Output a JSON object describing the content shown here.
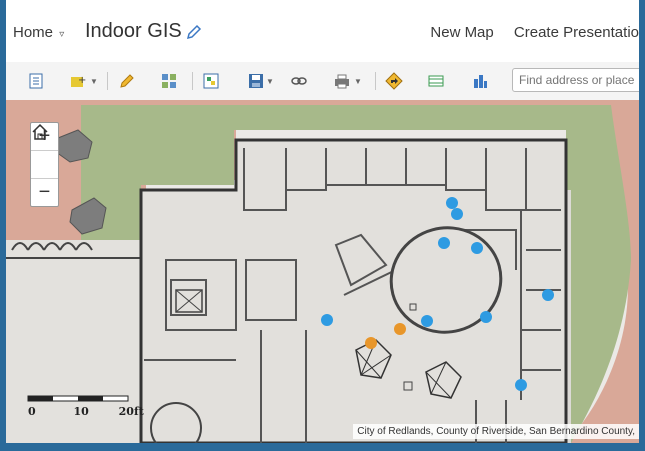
{
  "header": {
    "home_label": "Home",
    "home_caret": "▿",
    "app_title": "Indoor GIS",
    "nav": {
      "new_map": "New Map",
      "create_presentation": "Create Presentatio"
    }
  },
  "toolbar": {
    "search_placeholder": "Find address or place",
    "icons": [
      "details-icon",
      "add-content-icon",
      "edit-icon",
      "basemap-icon",
      "legend-icon",
      "save-icon",
      "share-link-icon",
      "print-icon",
      "directions-icon",
      "measure-icon",
      "analysis-icon"
    ]
  },
  "map": {
    "zoom_in": "+",
    "zoom_out": "−",
    "home_icon": "home-icon",
    "scale_labels": {
      "zero": "0",
      "ten": "10",
      "twenty": "20ft"
    },
    "attribution": "City of Redlands, County of Riverside, San Bernardino County,",
    "colors": {
      "blue_points": "#2e9be2",
      "orange_points": "#e8962a",
      "lawn": "#a7b98a",
      "soil": "#d9a898"
    }
  }
}
